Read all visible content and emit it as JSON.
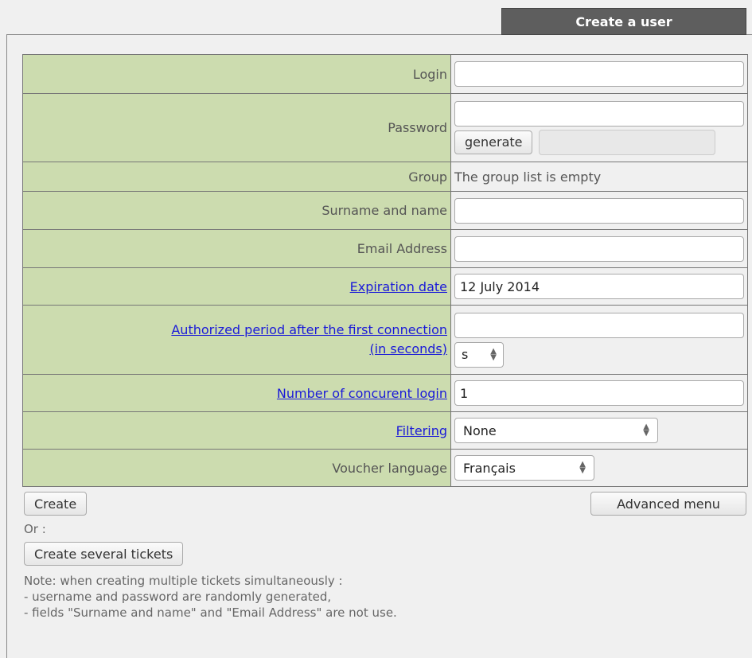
{
  "tab": {
    "title": "Create a user"
  },
  "form": {
    "login": {
      "label": "Login",
      "value": ""
    },
    "password": {
      "label": "Password",
      "value": "",
      "generate_label": "generate"
    },
    "group": {
      "label": "Group",
      "value": "The group list is empty"
    },
    "surname": {
      "label": "Surname and name",
      "value": ""
    },
    "email": {
      "label": "Email Address",
      "value": ""
    },
    "expiration": {
      "label": "Expiration date",
      "value": "12 July 2014"
    },
    "period": {
      "label_line1": "Authorized period after the first connection",
      "label_line2": "(in seconds)",
      "value": "",
      "unit": "s"
    },
    "concurrent": {
      "label": "Number of concurent login",
      "value": "1"
    },
    "filtering": {
      "label": "Filtering",
      "value": "None"
    },
    "voucher": {
      "label": "Voucher language",
      "value": "Français"
    }
  },
  "actions": {
    "create": "Create",
    "advanced": "Advanced menu",
    "or": "Or :",
    "several": "Create several tickets"
  },
  "note": {
    "line1": "Note: when creating multiple tickets simultaneously :",
    "line2": "- username and password are randomly generated,",
    "line3": "- fields \"Surname and name\" and \"Email Address\" are not use."
  }
}
